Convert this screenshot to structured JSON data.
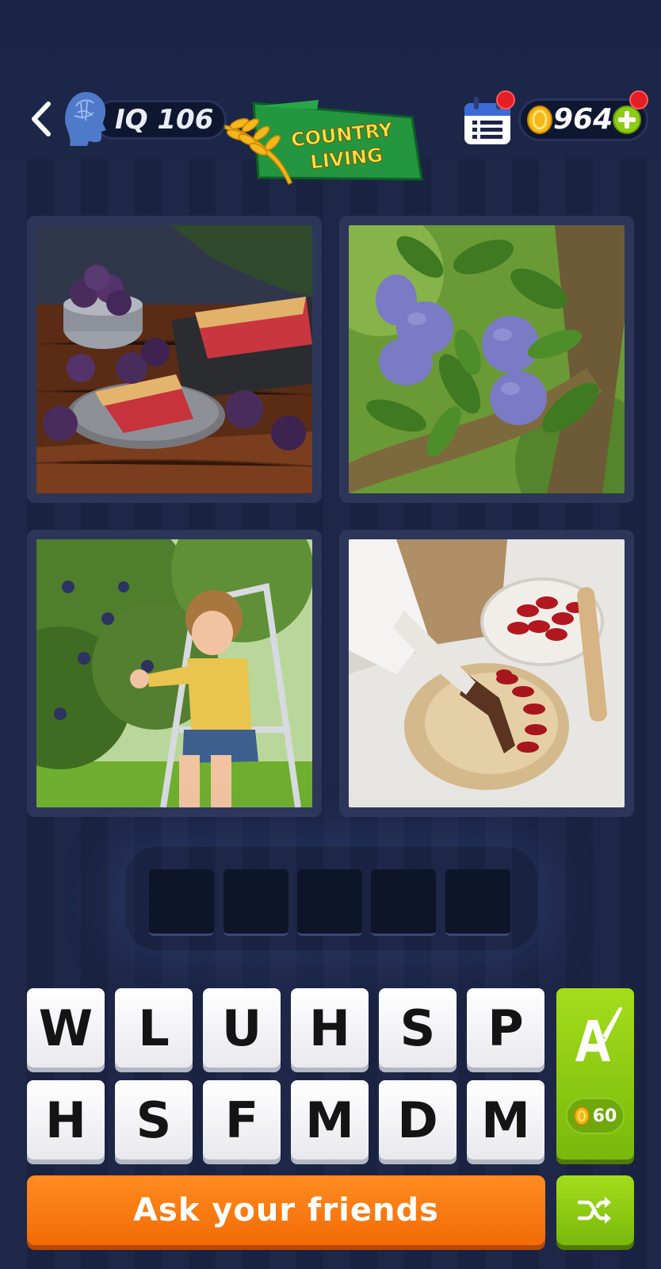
{
  "header": {
    "iq_label": "IQ 106",
    "coins": "964",
    "banner_line1": "COUNTRY",
    "banner_line2": "LIVING"
  },
  "photos": [
    {
      "description": "plum crumble cake slice on plate with plums"
    },
    {
      "description": "purple plums hanging on tree branch"
    },
    {
      "description": "child on ladder picking plums"
    },
    {
      "description": "hands placing plum slices into pie crust"
    }
  ],
  "answer": {
    "slots": [
      "",
      "",
      "",
      "",
      ""
    ]
  },
  "keyboard": {
    "row1": [
      "W",
      "L",
      "U",
      "H",
      "S",
      "P"
    ],
    "row2": [
      "H",
      "S",
      "F",
      "M",
      "D",
      "M"
    ]
  },
  "hint": {
    "cost": "60"
  },
  "ask_button": {
    "label": "Ask your friends"
  },
  "colors": {
    "background": "#1a2444",
    "ask_orange": "#f57c10",
    "hint_green": "#8ccc14",
    "badge_red": "#e41e25"
  }
}
